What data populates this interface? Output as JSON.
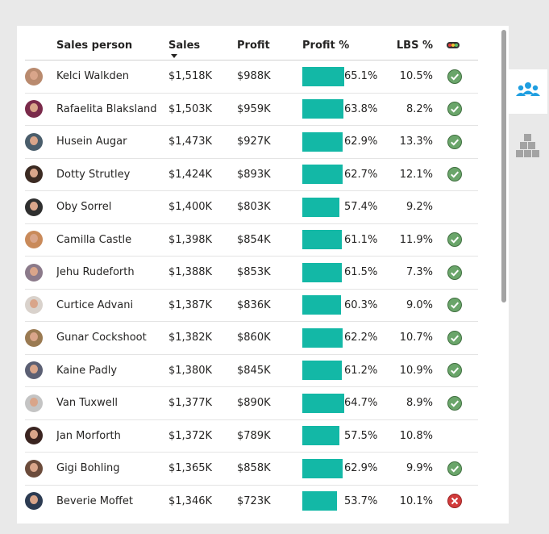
{
  "columns": {
    "sales_person": "Sales person",
    "sales": "Sales",
    "profit": "Profit",
    "profit_pct": "Profit %",
    "lbs_pct": "LBS %"
  },
  "sort": {
    "column": "sales",
    "direction": "descending"
  },
  "status_legend_icon": "traffic-light-icon",
  "colors": {
    "bar": "#13b8a6",
    "ok": "#6aa56a",
    "bad": "#d23b3b",
    "sidebar_active_icon": "#1f9ee0",
    "sidebar_inactive_icon": "#9a9a9a"
  },
  "sidebar": {
    "items": [
      {
        "icon": "people-icon",
        "active": true
      },
      {
        "icon": "stacked-boxes-icon",
        "active": false
      }
    ]
  },
  "rows": [
    {
      "name": "Kelci Walkden",
      "sales": "$1,518K",
      "profit": "$988K",
      "profit_pct": "65.1%",
      "profit_pct_value": 65.1,
      "lbs": "10.5%",
      "status": "ok",
      "avatar_color": "#b98a6e"
    },
    {
      "name": "Rafaelita Blaksland",
      "sales": "$1,503K",
      "profit": "$959K",
      "profit_pct": "63.8%",
      "profit_pct_value": 63.8,
      "lbs": "8.2%",
      "status": "ok",
      "avatar_color": "#7a2a4a"
    },
    {
      "name": "Husein Augar",
      "sales": "$1,473K",
      "profit": "$927K",
      "profit_pct": "62.9%",
      "profit_pct_value": 62.9,
      "lbs": "13.3%",
      "status": "ok",
      "avatar_color": "#4a5d6b"
    },
    {
      "name": "Dotty Strutley",
      "sales": "$1,424K",
      "profit": "$893K",
      "profit_pct": "62.7%",
      "profit_pct_value": 62.7,
      "lbs": "12.1%",
      "status": "ok",
      "avatar_color": "#3b2a22"
    },
    {
      "name": "Oby Sorrel",
      "sales": "$1,400K",
      "profit": "$803K",
      "profit_pct": "57.4%",
      "profit_pct_value": 57.4,
      "lbs": "9.2%",
      "status": "none",
      "avatar_color": "#2f2f2f"
    },
    {
      "name": "Camilla Castle",
      "sales": "$1,398K",
      "profit": "$854K",
      "profit_pct": "61.1%",
      "profit_pct_value": 61.1,
      "lbs": "11.9%",
      "status": "ok",
      "avatar_color": "#c98a5a"
    },
    {
      "name": "Jehu Rudeforth",
      "sales": "$1,388K",
      "profit": "$853K",
      "profit_pct": "61.5%",
      "profit_pct_value": 61.5,
      "lbs": "7.3%",
      "status": "ok",
      "avatar_color": "#8b7a8a"
    },
    {
      "name": "Curtice Advani",
      "sales": "$1,387K",
      "profit": "$836K",
      "profit_pct": "60.3%",
      "profit_pct_value": 60.3,
      "lbs": "9.0%",
      "status": "ok",
      "avatar_color": "#d9d2cc"
    },
    {
      "name": "Gunar Cockshoot",
      "sales": "$1,382K",
      "profit": "$860K",
      "profit_pct": "62.2%",
      "profit_pct_value": 62.2,
      "lbs": "10.7%",
      "status": "ok",
      "avatar_color": "#9a7a52"
    },
    {
      "name": "Kaine Padly",
      "sales": "$1,380K",
      "profit": "$845K",
      "profit_pct": "61.2%",
      "profit_pct_value": 61.2,
      "lbs": "10.9%",
      "status": "ok",
      "avatar_color": "#5b5f73"
    },
    {
      "name": "Van Tuxwell",
      "sales": "$1,377K",
      "profit": "$890K",
      "profit_pct": "64.7%",
      "profit_pct_value": 64.7,
      "lbs": "8.9%",
      "status": "ok",
      "avatar_color": "#c4c4c4"
    },
    {
      "name": "Jan Morforth",
      "sales": "$1,372K",
      "profit": "$789K",
      "profit_pct": "57.5%",
      "profit_pct_value": 57.5,
      "lbs": "10.8%",
      "status": "none",
      "avatar_color": "#3a2420"
    },
    {
      "name": "Gigi Bohling",
      "sales": "$1,365K",
      "profit": "$858K",
      "profit_pct": "62.9%",
      "profit_pct_value": 62.9,
      "lbs": "9.9%",
      "status": "ok",
      "avatar_color": "#6b4b3b"
    },
    {
      "name": "Beverie Moffet",
      "sales": "$1,346K",
      "profit": "$723K",
      "profit_pct": "53.7%",
      "profit_pct_value": 53.7,
      "lbs": "10.1%",
      "status": "bad",
      "avatar_color": "#2c3b52"
    }
  ]
}
